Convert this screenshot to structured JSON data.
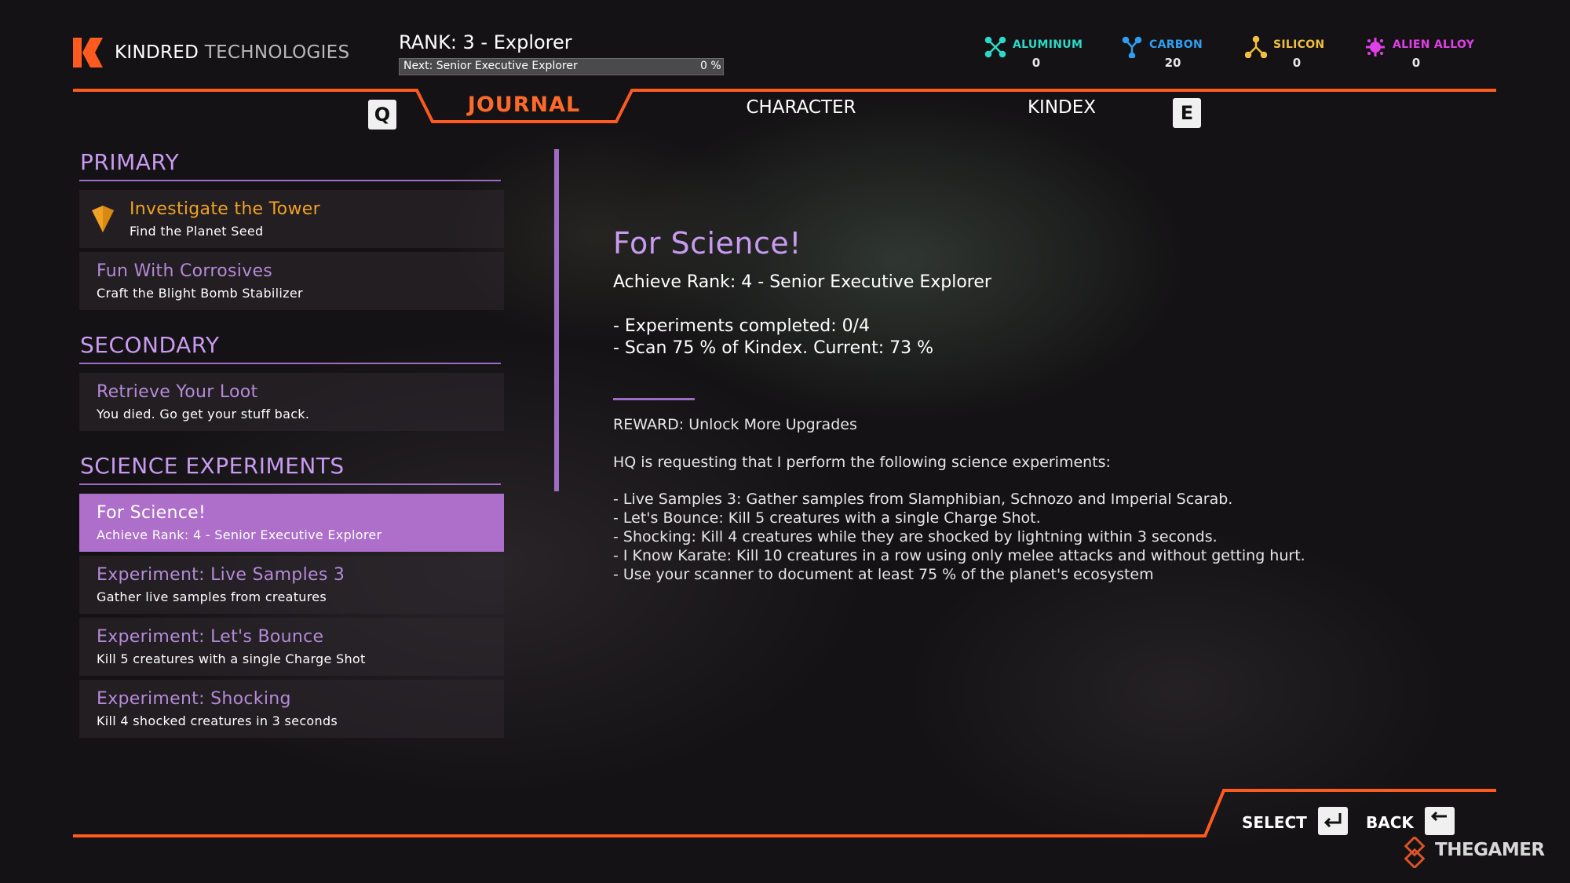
{
  "header": {
    "brand_primary": "KINDRED",
    "brand_secondary": "TECHNOLOGIES",
    "rank_title": "RANK: 3 - Explorer",
    "rank_next": "Next: Senior Executive Explorer",
    "rank_progress_label": "0 %",
    "rank_progress": 0
  },
  "resources": [
    {
      "name": "ALUMINUM",
      "value": "0",
      "color": "#2ed8c8",
      "icon": "aluminum-icon"
    },
    {
      "name": "CARBON",
      "value": "20",
      "color": "#2f9ef0",
      "icon": "carbon-icon"
    },
    {
      "name": "SILICON",
      "value": "0",
      "color": "#f0c040",
      "icon": "silicon-icon"
    },
    {
      "name": "ALIEN ALLOY",
      "value": "0",
      "color": "#e040e8",
      "icon": "alien-alloy-icon"
    }
  ],
  "tabs": {
    "prev_key": "Q",
    "next_key": "E",
    "items": [
      "JOURNAL",
      "CHARACTER",
      "KINDEX"
    ],
    "active": "JOURNAL"
  },
  "sections": {
    "primary": {
      "heading": "PRIMARY",
      "items": [
        {
          "title": "Investigate the Tower",
          "subtitle": "Find the Planet Seed"
        },
        {
          "title": "Fun With Corrosives",
          "subtitle": "Craft the Blight Bomb Stabilizer"
        }
      ]
    },
    "secondary": {
      "heading": "SECONDARY",
      "items": [
        {
          "title": "Retrieve Your Loot",
          "subtitle": "You died. Go get your stuff back."
        }
      ]
    },
    "science": {
      "heading": "SCIENCE EXPERIMENTS",
      "items": [
        {
          "title": "For Science!",
          "subtitle": "Achieve Rank: 4 - Senior Executive Explorer"
        },
        {
          "title": "Experiment: Live Samples 3",
          "subtitle": "Gather live samples from creatures"
        },
        {
          "title": "Experiment: Let's Bounce",
          "subtitle": "Kill 5 creatures with a single Charge Shot"
        },
        {
          "title": "Experiment: Shocking",
          "subtitle": "Kill 4 shocked creatures in 3 seconds"
        }
      ]
    }
  },
  "detail": {
    "title": "For Science!",
    "subtitle": "Achieve Rank: 4 - Senior Executive Explorer",
    "objectives": [
      "- Experiments completed: 0/4",
      "- Scan 75 % of Kindex. Current: 73 %"
    ],
    "reward": "REWARD: Unlock More Upgrades",
    "description": "HQ is requesting that I perform the following science experiments:",
    "list": [
      "- Live Samples 3: Gather samples from Slamphibian, Schnozo and Imperial Scarab.",
      "- Let's Bounce: Kill 5 creatures with a single Charge Shot.",
      "- Shocking: Kill 4 creatures while they are shocked by lightning within 3 seconds.",
      "- I Know Karate: Kill 10 creatures in a row using only melee attacks and without getting hurt.",
      "- Use your scanner to document at least 75 % of the planet's ecosystem"
    ]
  },
  "footer": {
    "select_label": "SELECT",
    "back_label": "BACK"
  },
  "watermark": "THEGAMER",
  "colors": {
    "accent_orange": "#ff6a2a",
    "accent_purple": "#c89af0",
    "selected_bg": "#ad6fca",
    "primary_gold": "#f0a224"
  }
}
